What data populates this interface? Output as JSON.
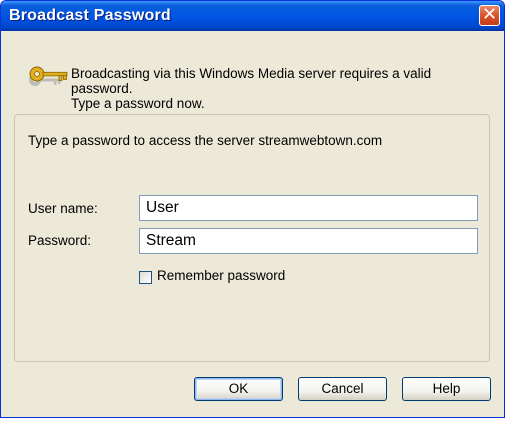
{
  "window": {
    "title": "Broadcast Password",
    "close_glyph": "✕"
  },
  "intro": {
    "line1": "Broadcasting via this Windows Media server requires a valid password.",
    "line2": "Type a password now.",
    "icon": "key-icon"
  },
  "form": {
    "server_prompt": "Type a password to access the server streamwebtown.com",
    "username_label": "User name:",
    "username_value": "User",
    "password_label": "Password:",
    "password_value": "Stream",
    "remember_label": "Remember password",
    "remember_checked": false
  },
  "buttons": {
    "ok": "OK",
    "cancel": "Cancel",
    "help": "Help"
  },
  "colors": {
    "titlebar": "#0055e5",
    "dialog_bg": "#ece9d8",
    "close_button": "#d9542c",
    "input_border": "#7f9db9"
  }
}
